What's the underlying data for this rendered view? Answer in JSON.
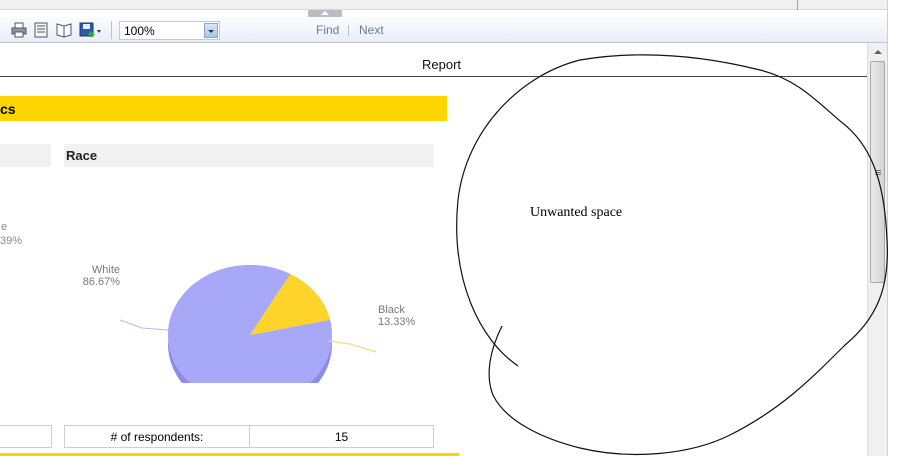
{
  "toolbar": {
    "zoom_value": "100%",
    "find_label": "Find",
    "next_label": "Next",
    "icons": [
      "printer-icon",
      "page-layout-icon",
      "page-setup-icon",
      "export-save-icon"
    ]
  },
  "report": {
    "title": "Report",
    "section_title": "cs",
    "race_header": "Race",
    "left_partial_label": "e",
    "left_partial_value": "39%",
    "respondents_label": "# of respondents:",
    "respondents_value": "15"
  },
  "chart_data": {
    "type": "pie",
    "title": "",
    "categories": [
      "White",
      "Black"
    ],
    "values": [
      86.67,
      13.33
    ],
    "labels": [
      "86.67%",
      "13.33%"
    ],
    "colors": [
      "#a8a8f8",
      "#ffd42a"
    ]
  },
  "annotation": {
    "text": "Unwanted space"
  },
  "colors": {
    "accent_yellow": "#ffd500",
    "toolbar_bg": "#eef2f8"
  }
}
